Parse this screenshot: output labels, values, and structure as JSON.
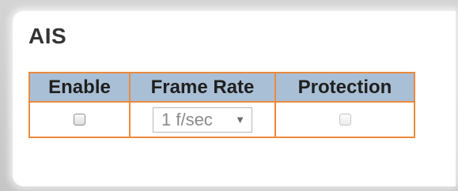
{
  "section": {
    "title": "AIS"
  },
  "table": {
    "headers": {
      "enable": "Enable",
      "frame_rate": "Frame Rate",
      "protection": "Protection"
    },
    "row": {
      "enable_checked": false,
      "frame_rate_value": "1 f/sec",
      "frame_rate_arrow": "▼",
      "protection_checked": false,
      "protection_disabled": true
    }
  },
  "colors": {
    "header_bg": "#a9bfd6",
    "border": "#ec8a3c",
    "title_text": "#333333"
  },
  "icons": {
    "select_arrow": "chevron-down-icon"
  }
}
